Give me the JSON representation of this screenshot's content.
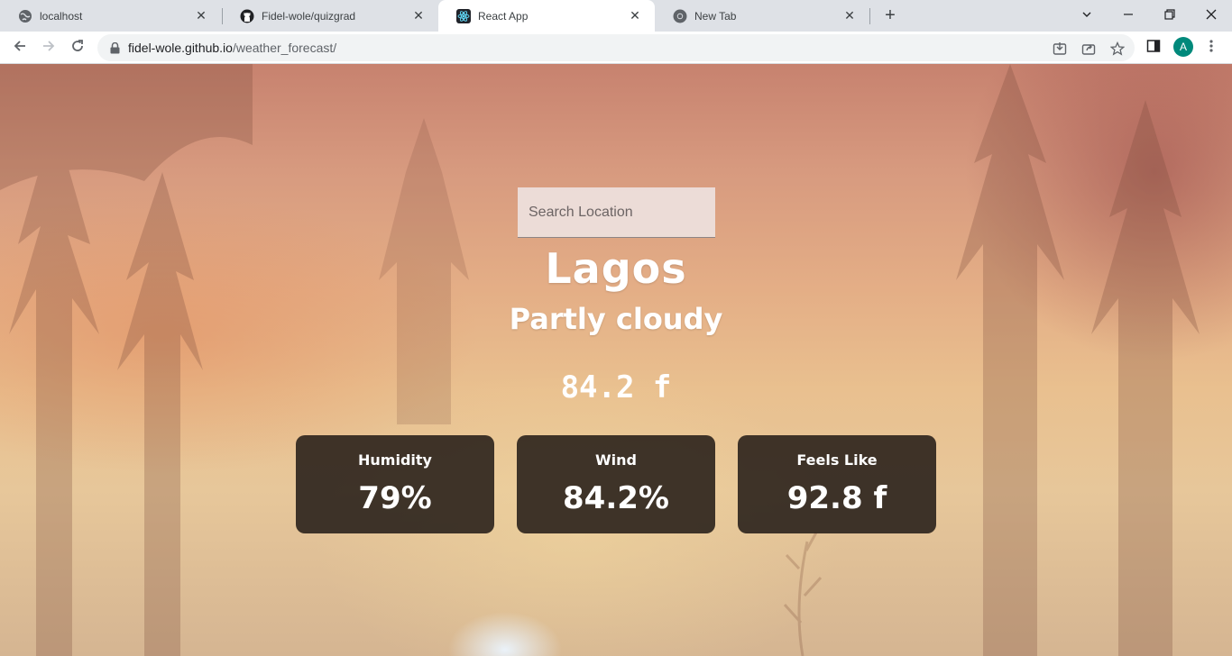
{
  "browser": {
    "tabs": [
      {
        "title": "localhost",
        "icon": "globe-icon",
        "active": false
      },
      {
        "title": "Fidel-wole/quizgrad",
        "icon": "github-icon",
        "active": false
      },
      {
        "title": "React App",
        "icon": "react-icon",
        "active": true
      },
      {
        "title": "New Tab",
        "icon": "chrome-icon",
        "active": false
      }
    ],
    "new_tab_label": "+",
    "close_glyph": "✕",
    "url_host": "fidel-wole.github.io",
    "url_path": "/weather_forecast/",
    "profile_initial": "A",
    "profile_color": "#00897b"
  },
  "weather": {
    "search_placeholder": "Search Location",
    "city": "Lagos",
    "condition": "Partly cloudy",
    "temperature": "84.2 f",
    "cards": [
      {
        "label": "Humidity",
        "value": "79%"
      },
      {
        "label": "Wind",
        "value": "84.2%"
      },
      {
        "label": "Feels Like",
        "value": "92.8 f"
      }
    ],
    "card_color": "#261e18"
  }
}
